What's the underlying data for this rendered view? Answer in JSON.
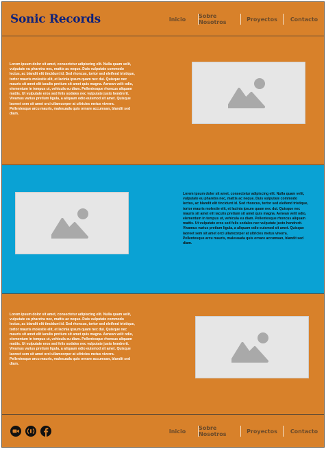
{
  "brand": {
    "name": "Sonic Records"
  },
  "nav": {
    "items": [
      {
        "label": "Inicio"
      },
      {
        "label": "Sobre Nosotros"
      },
      {
        "label": "Proyectos"
      },
      {
        "label": "Contacto"
      }
    ]
  },
  "sections": [
    {
      "text": "Lorem ipsum dolor sit amet, consectetur adipiscing elit. Nulla quam velit, vulputate eu pharetra nec, mattis ac neque. Duis vulputate commodo lectus, ac blandit elit tincidunt id. Sed rhoncus, tortor sed eleifend tristique, tortor mauris molestie elit, et lacinia ipsum quam nec dui. Quisque nec mauris sit amet elit iaculis pretium sit amet quis magna. Aenean velit odio, elementum in tempus ut, vehicula eu diam. Pellentesque rhoncus aliquam mattis. Ut vulputate eros sed felis sodales nec vulputate justo hendrerit. Vivamus varius pretium ligula, a aliquam odio euismod sit amet. Quisque laoreet sem sit amet orci ullamcorper at ultricies metus viverra. Pellentesque arcu mauris, malesuada quis ornare accumsan, blandit sed diam."
    },
    {
      "text": "Lorem ipsum dolor sit amet, consectetur adipiscing elit. Nulla quam velit, vulputate eu pharetra nec, mattis ac neque. Duis vulputate commodo lectus, ac blandit elit tincidunt id. Sed rhoncus, tortor sed eleifend tristique, tortor mauris molestie elit, et lacinia ipsum quam nec dui. Quisque nec mauris sit amet elit iaculis pretium sit amet quis magna. Aenean velit odio, elementum in tempus ut, vehicula eu diam. Pellentesque rhoncus aliquam mattis. Ut vulputate eros sed felis sodales nec vulputate justo hendrerit. Vivamus varius pretium ligula, a aliquam odio euismod sit amet. Quisque laoreet sem sit amet orci ullamcorper at ultricies metus viverra. Pellentesque arcu mauris, malesuada quis ornare accumsan, blandit sed diam."
    },
    {
      "text": "Lorem ipsum dolor sit amet, consectetur adipiscing elit. Nulla quam velit, vulputate eu pharetra nec, mattis ac neque. Duis vulputate commodo lectus, ac blandit elit tincidunt id. Sed rhoncus, tortor sed eleifend tristique, tortor mauris molestie elit, et lacinia ipsum quam nec dui. Quisque nec mauris sit amet elit iaculis pretium sit amet quis magna. Aenean velit odio, elementum in tempus ut, vehicula eu diam. Pellentesque rhoncus aliquam mattis. Ut vulputate eros sed felis sodales nec vulputate justo hendrerit. Vivamus varius pretium ligula, a aliquam odio euismod sit amet. Quisque laoreet sem sit amet orci ullamcorper at ultricies metus viverra. Pellentesque arcu mauris, malesuada quis ornare accumsan, blandit sed diam."
    }
  ],
  "images": [
    "image-placeholder-icon",
    "image-placeholder-icon",
    "image-placeholder-icon"
  ],
  "social": [
    "video-camera-icon",
    "podcast-icon",
    "facebook-icon"
  ],
  "colors": {
    "orange": "#d8812a",
    "blue": "#0aa2d4",
    "brand": "#10227a"
  }
}
